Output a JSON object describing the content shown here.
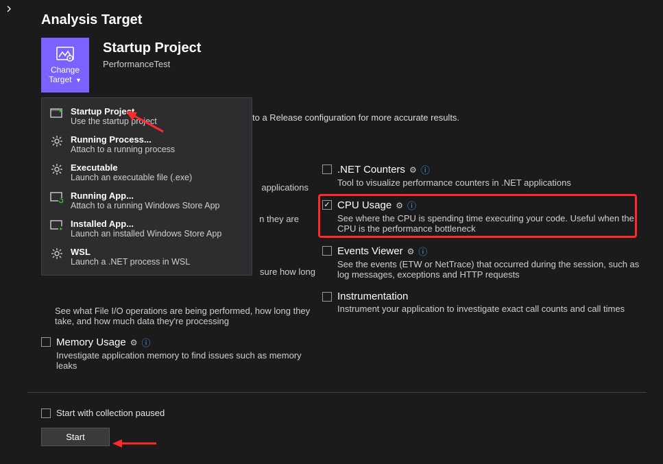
{
  "header": {
    "title": "Analysis Target"
  },
  "target_tile": {
    "line1": "Change",
    "line2": "Target"
  },
  "target": {
    "title": "Startup Project",
    "subtitle": "PerformanceTest"
  },
  "hint_fragment": "to a Release configuration for more accurate results.",
  "dropdown": {
    "items": [
      {
        "title": "Startup Project",
        "desc": "Use the startup project"
      },
      {
        "title": "Running Process...",
        "desc": "Attach to a running process"
      },
      {
        "title": "Executable",
        "desc": "Launch an executable file (.exe)"
      },
      {
        "title": "Running App...",
        "desc": "Attach to a running Windows Store App"
      },
      {
        "title": "Installed App...",
        "desc": "Launch an installed Windows Store App"
      },
      {
        "title": "WSL",
        "desc": "Launch a .NET process in WSL"
      }
    ]
  },
  "left_fragments": {
    "f1": "applications",
    "f2": "n they are",
    "f3": "sure how long"
  },
  "tools_left": {
    "fileio": {
      "title_visible": "",
      "desc": "See what File I/O operations are being performed, how long they take, and how much data they're processing"
    },
    "memory": {
      "title": "Memory Usage",
      "desc": "Investigate application memory to find issues such as memory leaks"
    }
  },
  "tools_right": {
    "counters": {
      "title": ".NET Counters",
      "desc": "Tool to visualize performance counters in .NET applications"
    },
    "cpu": {
      "title": "CPU Usage",
      "desc": "See where the CPU is spending time executing your code. Useful when the CPU is the performance bottleneck"
    },
    "events": {
      "title": "Events Viewer",
      "desc": "See the events (ETW or NetTrace) that occurred during the session, such as log messages, exceptions and HTTP requests"
    },
    "instr": {
      "title": "Instrumentation",
      "desc": "Instrument your application to investigate exact call counts and call times"
    }
  },
  "start": {
    "paused_label": "Start with collection paused",
    "button": "Start"
  }
}
